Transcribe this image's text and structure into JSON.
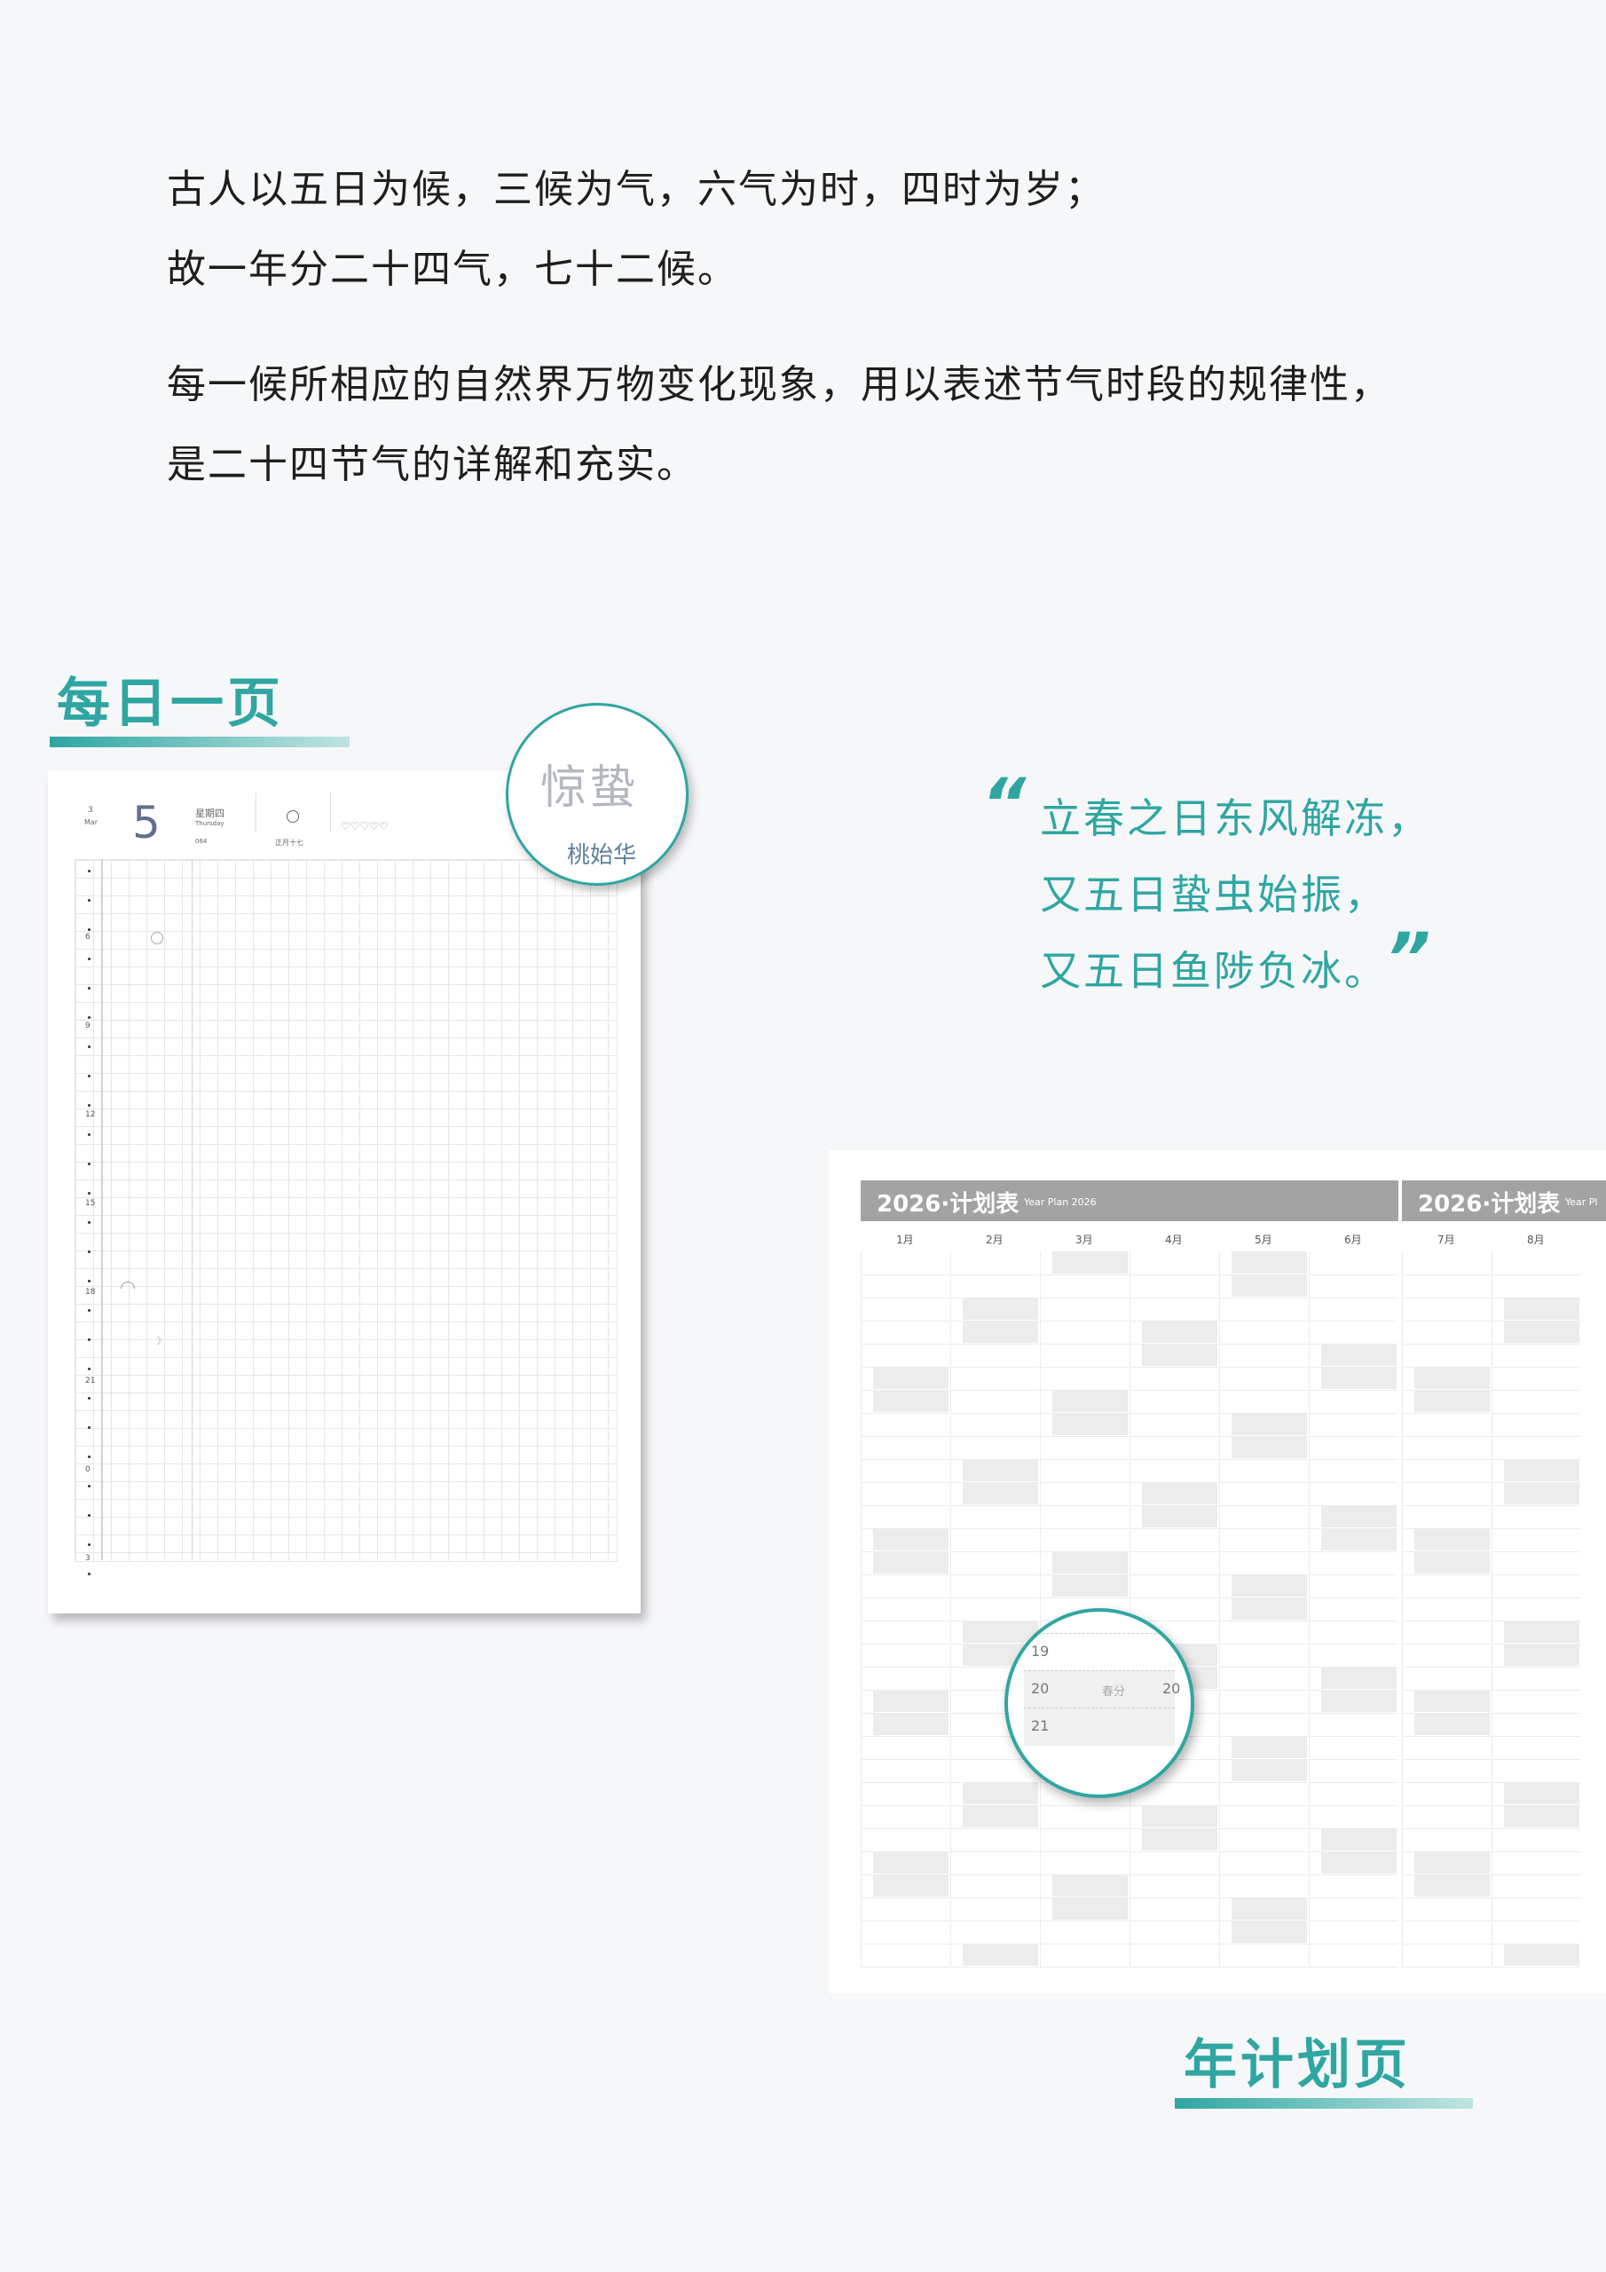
{
  "intro": {
    "lines": [
      "古人以五日为候，三候为气，六气为时，四时为岁；",
      "故一年分二十四气，七十二候。",
      "每一候所相应的自然界万物变化现象，用以表述节气时段的规律性，",
      "是二十四节气的详解和充实。"
    ]
  },
  "daily_section": {
    "title": "每日一页",
    "header": {
      "month_num": "3",
      "month_en": "Mar",
      "day": "5",
      "weekday_cn": "星期四",
      "weekday_en": "Thursday",
      "day_of_year": "064",
      "moon_icon": "moon-icon",
      "lunar_date": "正月十七",
      "hearts": "♡♡♡♡♡"
    },
    "hours": [
      "6",
      "9",
      "12",
      "15",
      "18",
      "21",
      "0",
      "3"
    ],
    "badge": {
      "term": "惊蛰",
      "phenology": "桃始华"
    }
  },
  "quote": {
    "open_mark": "“",
    "close_mark": "”",
    "lines": [
      "立春之日东风解冻，",
      "又五日蛰虫始振，",
      "又五日鱼陟负冰。"
    ]
  },
  "year_section": {
    "title": "年计划页",
    "left_sheet": {
      "title": "2026·计划表",
      "title_en": "Year Plan 2026",
      "months": [
        "1月",
        "2月",
        "3月",
        "4月",
        "5月",
        "6月"
      ]
    },
    "right_sheet": {
      "title": "2026·计划表",
      "title_en": "Year Pl",
      "months": [
        "7月",
        "8月"
      ]
    },
    "magnifier": {
      "rows": [
        "19",
        "20",
        "21"
      ],
      "term": "春分",
      "edge_label": "20"
    }
  },
  "colors": {
    "accent": "#2fa6a2",
    "header_gray": "#a3a3a3"
  }
}
